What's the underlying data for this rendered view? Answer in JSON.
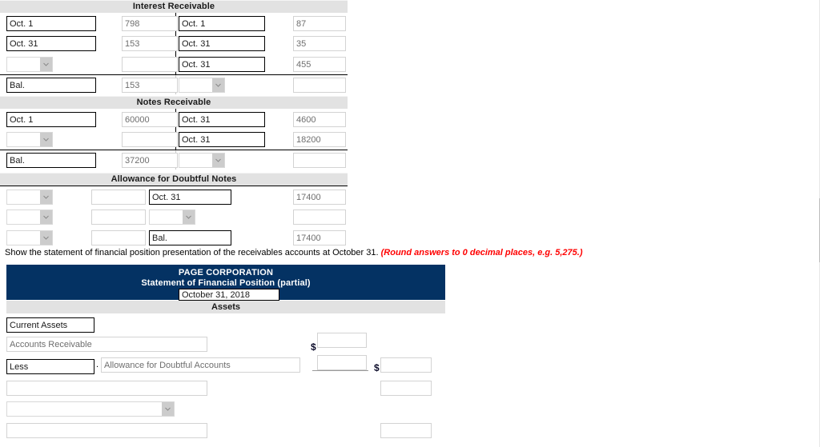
{
  "accounts": [
    {
      "title": "Interest Receivable",
      "left_rows": [
        {
          "label": "Oct. 1",
          "label_state": "filled",
          "amount": "798",
          "amount_state": "value"
        },
        {
          "label": "Oct. 31",
          "label_state": "filled",
          "amount": "153",
          "amount_state": "value"
        },
        {
          "label": "",
          "label_state": "select",
          "amount": "",
          "amount_state": "blank"
        }
      ],
      "right_rows": [
        {
          "label": "Oct. 1",
          "label_state": "filled",
          "amount": "87",
          "amount_state": "value"
        },
        {
          "label": "Oct. 31",
          "label_state": "filled",
          "amount": "35",
          "amount_state": "value"
        },
        {
          "label": "Oct. 31",
          "label_state": "filled",
          "amount": "455",
          "amount_state": "value"
        }
      ],
      "bal_left": {
        "label": "Bal.",
        "label_state": "filled",
        "amount": "153",
        "amount_state": "value"
      },
      "bal_right": {
        "label": "",
        "label_state": "select",
        "amount": "",
        "amount_state": "blank"
      }
    },
    {
      "title": "Notes Receivable",
      "left_rows": [
        {
          "label": "Oct. 1",
          "label_state": "filled",
          "amount": "60000",
          "amount_state": "value"
        },
        {
          "label": "",
          "label_state": "select",
          "amount": "",
          "amount_state": "blank"
        }
      ],
      "right_rows": [
        {
          "label": "Oct. 31",
          "label_state": "filled",
          "amount": "4600",
          "amount_state": "value"
        },
        {
          "label": "Oct. 31",
          "label_state": "filled",
          "amount": "18200",
          "amount_state": "value"
        }
      ],
      "bal_left": {
        "label": "Bal.",
        "label_state": "filled",
        "amount": "37200",
        "amount_state": "value"
      },
      "bal_right": {
        "label": "",
        "label_state": "select",
        "amount": "",
        "amount_state": "blank"
      }
    },
    {
      "title": "Allowance for Doubtful Notes",
      "left_rows": [
        {
          "label": "",
          "label_state": "select",
          "amount": "",
          "amount_state": "blank"
        },
        {
          "label": "",
          "label_state": "select",
          "amount": "",
          "amount_state": "blank"
        },
        {
          "label": "",
          "label_state": "select",
          "amount": "",
          "amount_state": "blank"
        }
      ],
      "right_rows": [
        {
          "label": "Oct. 31",
          "label_state": "filled",
          "amount": "17400",
          "amount_state": "value"
        },
        {
          "label": "",
          "label_state": "select",
          "amount": "",
          "amount_state": "blank"
        },
        {
          "label": "Bal.",
          "label_state": "filled",
          "amount": "17400",
          "amount_state": "value"
        }
      ]
    }
  ],
  "instruction": {
    "text": "Show the statement of financial position presentation of the receivables accounts at October 31.",
    "note": "(Round answers to 0 decimal places, e.g. 5,275.)"
  },
  "statement": {
    "company": "PAGE CORPORATION",
    "title": "Statement of Financial Position (partial)",
    "date": "October 31, 2018",
    "section_band": "Assets",
    "rows": [
      {
        "label": "Current Assets",
        "label_state": "filled",
        "col1": "",
        "col2": ""
      },
      {
        "label": "Accounts Receivable",
        "label_state": "value",
        "col1": "",
        "col2": ""
      },
      {
        "label": "Less",
        "label_state": "filled",
        "sub_label": "Allowance for Doubtful Accounts",
        "sub_state": "value",
        "col1": "",
        "col2": ""
      },
      {
        "label": "",
        "label_state": "blank",
        "col1": "",
        "col2": ""
      },
      {
        "label": "",
        "label_state": "select",
        "col1": "",
        "col2": ""
      },
      {
        "label": "",
        "label_state": "blank",
        "col1": "",
        "col2": ""
      }
    ],
    "dollar_sign": "$",
    "separator": "."
  },
  "colors": {
    "header_blue": "#043263",
    "band_gray": "#e2e2e2",
    "note_red": "#ff0000"
  },
  "icons": {
    "dropdown": "chevron-down-icon"
  }
}
